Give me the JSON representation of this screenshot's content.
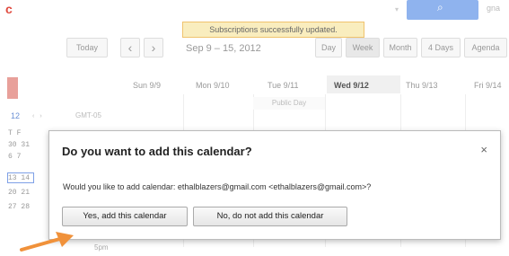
{
  "header": {
    "logo_fragment": "c",
    "account_fragment": "gna",
    "notice": "Subscriptions successfully updated."
  },
  "toolbar": {
    "today": "Today",
    "prev": "‹",
    "next": "›",
    "date_range": "Sep 9 – 15, 2012",
    "views": [
      "Day",
      "Week",
      "Month",
      "4 Days",
      "Agenda"
    ]
  },
  "grid": {
    "columns": [
      "Sun 9/9",
      "Mon 9/10",
      "Tue 9/11",
      "Wed 9/12",
      "Thu 9/13",
      "Fri 9/14"
    ],
    "event": "Public Day",
    "timezone": "GMT-05",
    "footer_text": "5pm"
  },
  "mini_calendar": {
    "month_label": "12",
    "rows": [
      "T  F",
      "30 31",
      "6  7",
      "13 14",
      "20 21",
      "27 28"
    ]
  },
  "dialog": {
    "title": "Do you want to add this calendar?",
    "close": "×",
    "message": "Would you like to add calendar: ethalblazers@gmail.com <ethalblazers@gmail.com>?",
    "yes_button": "Yes, add this calendar",
    "no_button": "No, do not add this calendar"
  },
  "colors": {
    "arrow": "#f0913a",
    "notice_bg": "#f9edbe",
    "search_blue": "#8fb3ee"
  }
}
